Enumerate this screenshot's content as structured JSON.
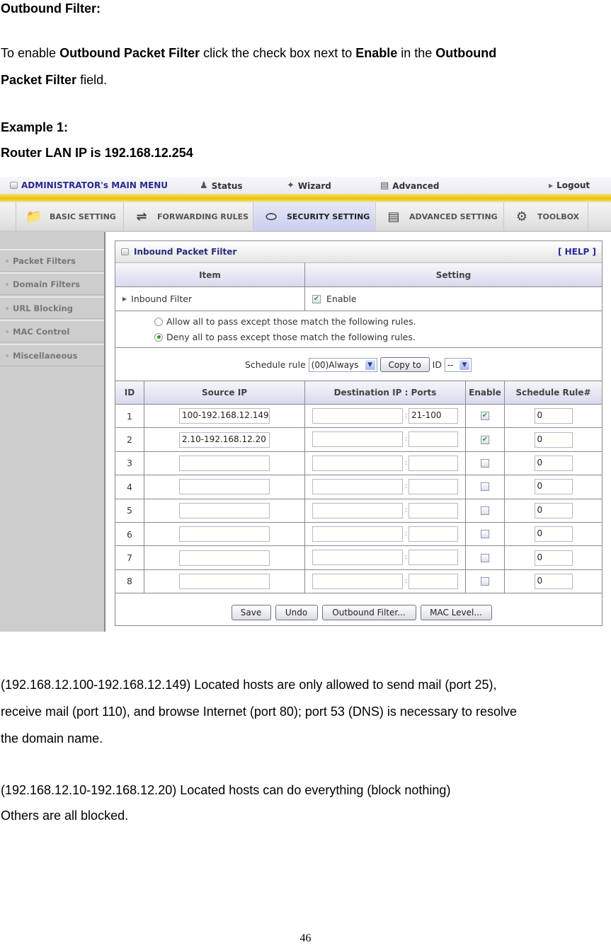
{
  "doc": {
    "heading": "Outbound Filter:",
    "intro": {
      "p1": "To enable ",
      "b1": "Outbound Packet Filter",
      "p2": " click the check box next to ",
      "b2": "Enable",
      "p3": " in the ",
      "b3": "Outbound",
      "b4": "Packet Filter",
      "p4": " field."
    },
    "example_title": "Example 1:",
    "router_ip": "Router LAN IP is 192.168.12.254",
    "para1_line1": "(192.168.12.100-192.168.12.149) Located hosts are only allowed to send mail (port 25),",
    "para1_line2": "receive mail (port 110), and browse Internet (port 80); port 53 (DNS) is necessary to resolve",
    "para1_line3": "the domain name.",
    "para2_line1": "(192.168.12.10-192.168.12.20) Located hosts can do everything (block nothing)",
    "para2_line2": "Others are all blocked.",
    "page_number": "46"
  },
  "topbar": {
    "main_menu": "ADMINISTRATOR's MAIN MENU",
    "status": "Status",
    "wizard": "Wizard",
    "advanced": "Advanced",
    "logout": "Logout"
  },
  "tabs": [
    {
      "label": "BASIC SETTING",
      "icon": "folder-icon"
    },
    {
      "label": "FORWARDING RULES",
      "icon": "forwarding-icon"
    },
    {
      "label": "SECURITY SETTING",
      "icon": "security-icon",
      "active": true
    },
    {
      "label": "ADVANCED SETTING",
      "icon": "advanced-icon"
    },
    {
      "label": "TOOLBOX",
      "icon": "toolbox-icon"
    }
  ],
  "sidebar": {
    "items": [
      {
        "label": "Packet Filters"
      },
      {
        "label": "Domain Filters"
      },
      {
        "label": "URL Blocking"
      },
      {
        "label": "MAC Control"
      },
      {
        "label": "Miscellaneous"
      }
    ]
  },
  "panel": {
    "title": "Inbound Packet Filter",
    "help": "[ HELP ]",
    "col_item": "Item",
    "col_setting": "Setting",
    "filter_label": "Inbound Filter",
    "enable_label": "Enable",
    "enable_checked": true,
    "radio_allow": "Allow all to pass except those match the following rules.",
    "radio_deny": "Deny all to pass except those match the following rules.",
    "radio_selected": "deny",
    "schedule_label": "Schedule rule",
    "schedule_value": "(00)Always",
    "copy_to": "Copy to",
    "id_label": "ID",
    "id_value": "--",
    "table_headers": {
      "id": "ID",
      "source_ip": "Source IP",
      "dest": "Destination IP : Ports",
      "enable": "Enable",
      "schedule": "Schedule Rule#"
    },
    "rules": [
      {
        "id": "1",
        "source_ip": "100-192.168.12.149",
        "dest_ip": "",
        "ports": "21-100",
        "enabled": true,
        "schedule": "0"
      },
      {
        "id": "2",
        "source_ip": "2.10-192.168.12.20",
        "dest_ip": "",
        "ports": "",
        "enabled": true,
        "schedule": "0"
      },
      {
        "id": "3",
        "source_ip": "",
        "dest_ip": "",
        "ports": "",
        "enabled": false,
        "schedule": "0"
      },
      {
        "id": "4",
        "source_ip": "",
        "dest_ip": "",
        "ports": "",
        "enabled": false,
        "schedule": "0"
      },
      {
        "id": "5",
        "source_ip": "",
        "dest_ip": "",
        "ports": "",
        "enabled": false,
        "schedule": "0"
      },
      {
        "id": "6",
        "source_ip": "",
        "dest_ip": "",
        "ports": "",
        "enabled": false,
        "schedule": "0"
      },
      {
        "id": "7",
        "source_ip": "",
        "dest_ip": "",
        "ports": "",
        "enabled": false,
        "schedule": "0"
      },
      {
        "id": "8",
        "source_ip": "",
        "dest_ip": "",
        "ports": "",
        "enabled": false,
        "schedule": "0"
      }
    ],
    "buttons": {
      "save": "Save",
      "undo": "Undo",
      "outbound": "Outbound Filter...",
      "mac": "MAC Level..."
    }
  },
  "colors": {
    "menu_text": "#2a2a8c",
    "accent_yellow": "#e8c400",
    "check_green": "#22a022",
    "header_band": "#d9d9ef"
  }
}
